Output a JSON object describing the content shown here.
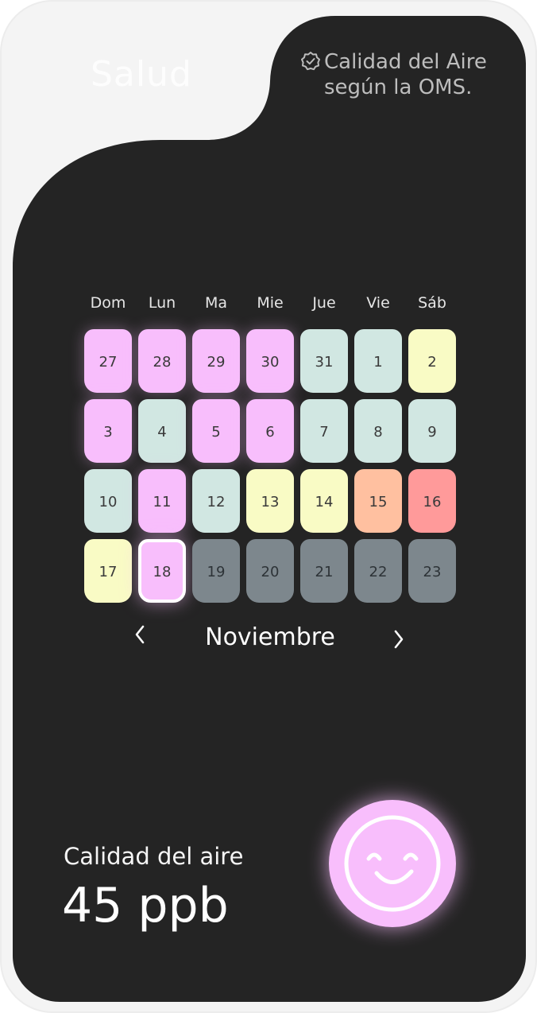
{
  "header": {
    "title": "Salud",
    "badge_line1": "Calidad del Aire",
    "badge_line2": "según la OMS.",
    "badge_icon": "verified-check-icon"
  },
  "calendar": {
    "weekdays": [
      "Dom",
      "Lun",
      "Ma",
      "Mie",
      "Jue",
      "Vie",
      "Sáb"
    ],
    "days": [
      {
        "label": "27",
        "status": "pink"
      },
      {
        "label": "28",
        "status": "pink"
      },
      {
        "label": "29",
        "status": "pink"
      },
      {
        "label": "30",
        "status": "pink"
      },
      {
        "label": "31",
        "status": "mint"
      },
      {
        "label": "1",
        "status": "mint"
      },
      {
        "label": "2",
        "status": "yellow"
      },
      {
        "label": "3",
        "status": "pink"
      },
      {
        "label": "4",
        "status": "mint"
      },
      {
        "label": "5",
        "status": "pink"
      },
      {
        "label": "6",
        "status": "pink"
      },
      {
        "label": "7",
        "status": "mint"
      },
      {
        "label": "8",
        "status": "mint"
      },
      {
        "label": "9",
        "status": "mint"
      },
      {
        "label": "10",
        "status": "mint"
      },
      {
        "label": "11",
        "status": "pink"
      },
      {
        "label": "12",
        "status": "mint"
      },
      {
        "label": "13",
        "status": "yellow"
      },
      {
        "label": "14",
        "status": "yellow"
      },
      {
        "label": "15",
        "status": "orange"
      },
      {
        "label": "16",
        "status": "red"
      },
      {
        "label": "17",
        "status": "yellow"
      },
      {
        "label": "18",
        "status": "pink",
        "selected": true
      },
      {
        "label": "19",
        "status": "gray"
      },
      {
        "label": "20",
        "status": "gray"
      },
      {
        "label": "21",
        "status": "gray"
      },
      {
        "label": "22",
        "status": "gray"
      },
      {
        "label": "23",
        "status": "gray"
      }
    ],
    "month": "Noviembre",
    "prev_icon": "chevron-left-icon",
    "next_icon": "chevron-right-icon"
  },
  "quality": {
    "label": "Calidad del aire",
    "value": "45 ppb",
    "face_icon": "smiley-face-icon"
  },
  "colors": {
    "background_dark": "#242424",
    "frame": "#f4f4f4",
    "pink": "#f8befc",
    "mint": "#d1e7e2",
    "yellow": "#f9fbc5",
    "orange": "#ffc0a0",
    "red": "#ff9a9a",
    "gray": "#7d878d"
  }
}
